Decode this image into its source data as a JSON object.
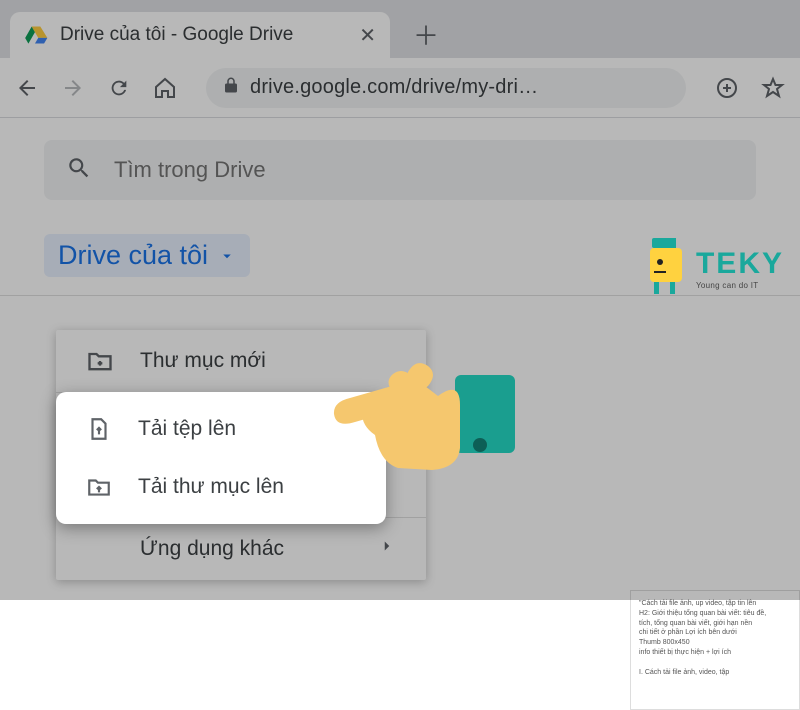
{
  "tab": {
    "title": "Drive của tôi - Google Drive"
  },
  "url": "drive.google.com/drive/my-dri…",
  "search": {
    "placeholder": "Tìm trong Drive"
  },
  "breadcrumb": {
    "label": "Drive của tôi"
  },
  "menu": {
    "new_folder": "Thư mục mới",
    "upload_file": "Tải tệp lên",
    "upload_folder": "Tải thư mục lên",
    "more_apps": "Ứng dụng khác"
  },
  "logo": {
    "brand": "TEKY",
    "tag": "Young can do IT"
  },
  "doc_preview": "\"Cách tải file ảnh, up video, tập tin lên\nH2: Giới thiệu tổng quan bài viết: tiêu đề,\ntích, tổng quan bài viết, giới hạn nền\nchi tiết ở phần Lợi ích bên dưới\nThumb 800x450\ninfo thiết bị thực hiện + lợi ích\n\nI. Cách tải file ảnh, video, tập"
}
